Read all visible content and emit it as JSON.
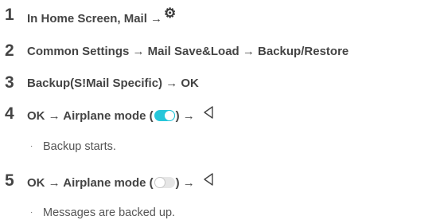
{
  "steps": [
    {
      "number": "1",
      "text": "In Home Screen, Mail →",
      "icon": "gear-icon"
    },
    {
      "number": "2",
      "text": "Common Settings → Mail Save&Load → Backup/Restore"
    },
    {
      "number": "3",
      "text": "Backup(S!Mail Specific) → OK"
    },
    {
      "number": "4",
      "text_before": "OK → Airplane mode (",
      "text_after": ") →",
      "toggle_state": "on",
      "icon": "back-triangle-icon"
    },
    {
      "number": "5",
      "text_before": "OK → Airplane mode (",
      "text_after": ") →",
      "toggle_state": "off",
      "icon": "back-triangle-icon"
    }
  ],
  "notes": [
    {
      "bullet": "·",
      "text": "Backup starts."
    },
    {
      "bullet": "·",
      "text": "Messages are backed up."
    }
  ],
  "colors": {
    "text": "#444444",
    "toggle_on": "#26c6da",
    "toggle_off": "#e6e6e6"
  }
}
